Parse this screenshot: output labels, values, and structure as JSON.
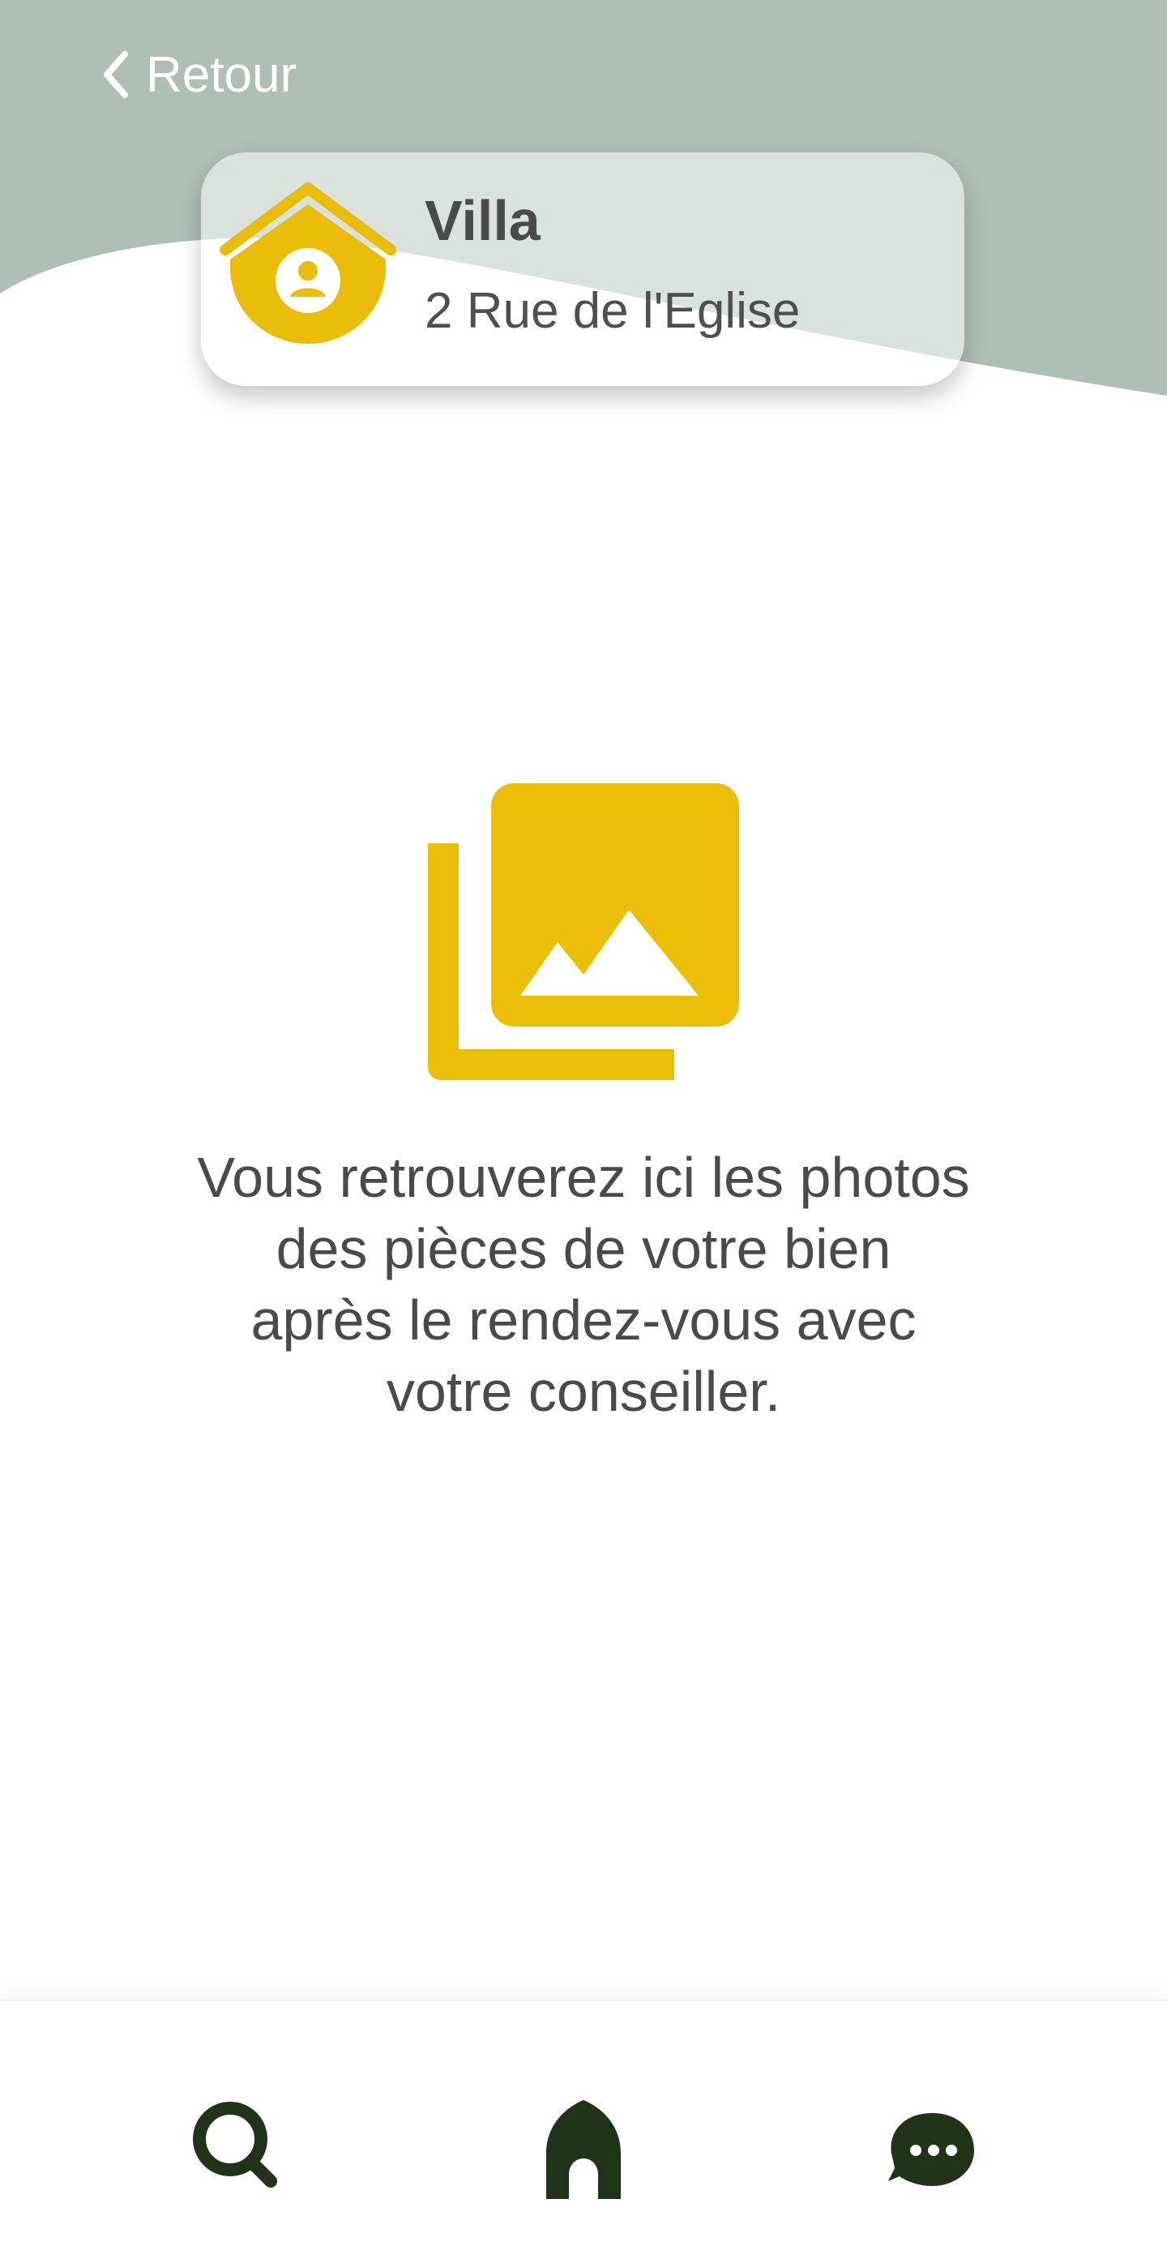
{
  "header": {
    "back_label": "Retour",
    "colors": {
      "background": "#aebfb6",
      "text": "#ffffff"
    }
  },
  "property": {
    "title": "Villa",
    "address": "2 Rue de l'Eglise",
    "icon": "house-person-icon",
    "icon_color": "#e9bd0a"
  },
  "empty_state": {
    "icon": "photo-library-icon",
    "icon_color": "#ecbe0a",
    "message_lines": [
      "Vous retrouverez ici les photos",
      "des pièces de votre bien",
      "après le rendez-vous avec",
      "votre conseiller."
    ]
  },
  "bottom_nav": {
    "items": [
      {
        "name": "search",
        "icon": "search-icon"
      },
      {
        "name": "home",
        "icon": "home-icon"
      },
      {
        "name": "chat",
        "icon": "chat-bubble-icon"
      }
    ],
    "icon_color": "#1f3318"
  }
}
